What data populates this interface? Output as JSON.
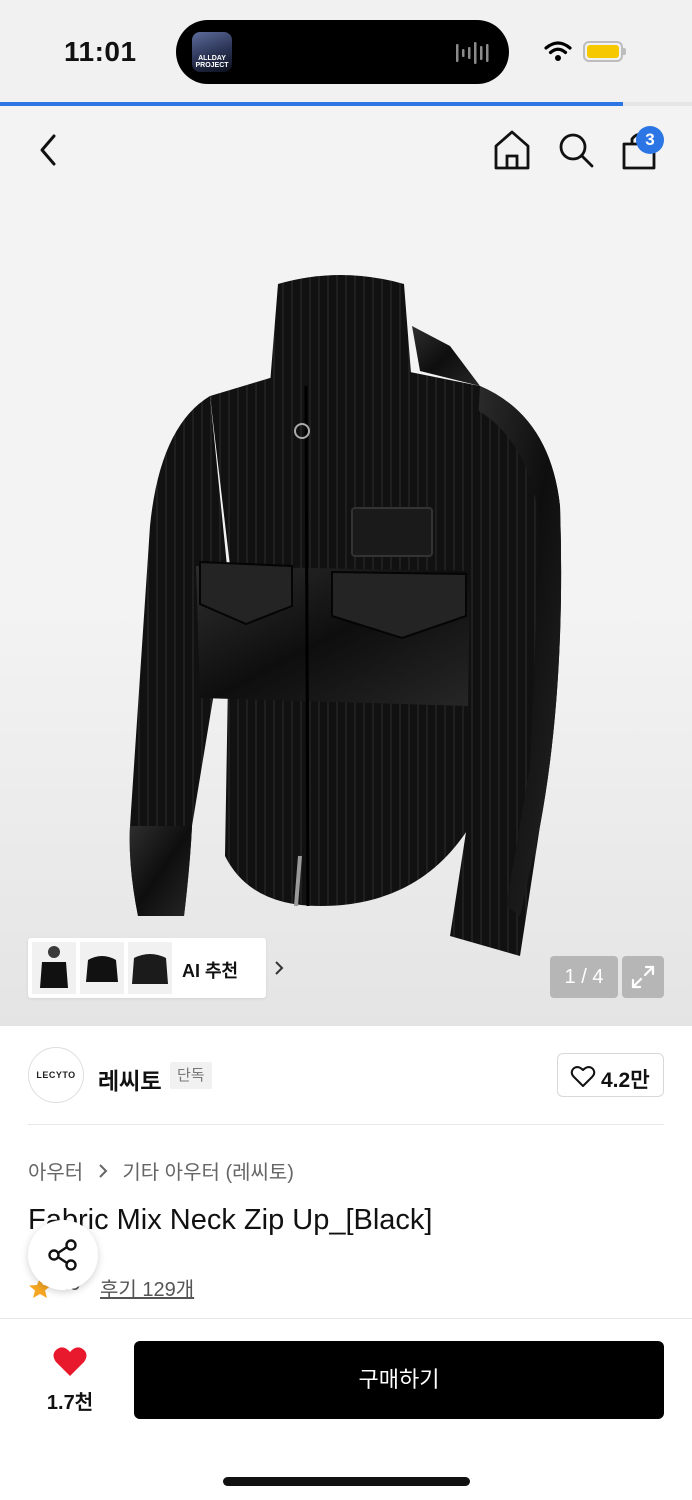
{
  "status_bar": {
    "time": "11:01",
    "live_activity_art_text": "ALLDAY PROJECT",
    "battery_color": "#f5c800",
    "loading_progress": 0.9
  },
  "nav": {
    "back_icon": "chevron-left-icon",
    "home_icon": "home-icon",
    "search_icon": "search-icon",
    "cart_icon": "shopping-bag-icon",
    "cart_badge": "3"
  },
  "gallery": {
    "recommend_label": "AI 추천",
    "counter": "1 / 4",
    "current": 1,
    "total": 4
  },
  "brand": {
    "logo_text": "LECYTO",
    "name": "레씨토",
    "tag": "단독",
    "likes": "4.2만"
  },
  "product": {
    "breadcrumb": [
      "아우터",
      "기타 아우터 (레씨토)"
    ],
    "title": "Fabric Mix Neck Zip Up_[Black]",
    "rating_visible": ".9",
    "reviews": "후기 129개"
  },
  "bottom_bar": {
    "wish_count": "1.7천",
    "buy_label": "구매하기",
    "accent": "#e8192c"
  }
}
